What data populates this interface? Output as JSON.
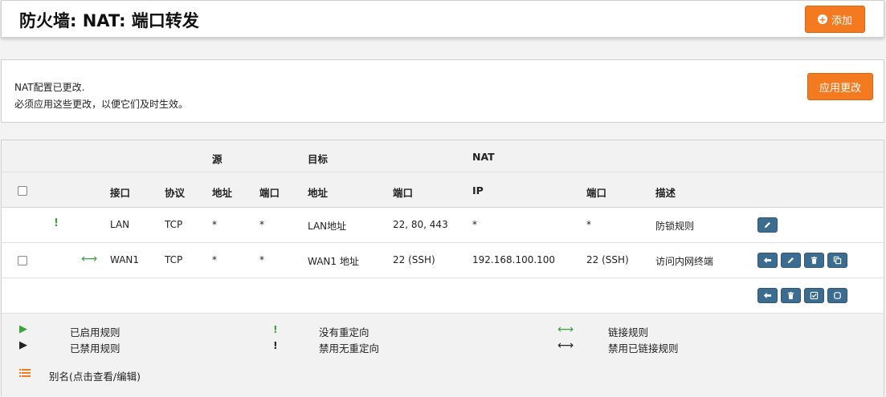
{
  "header": {
    "title": "防火墙: NAT: 端口转发",
    "add_label": "添加"
  },
  "notice": {
    "line1": "NAT配置已更改.",
    "line2": "必须应用这些更改，以便它们及时生效。",
    "apply_label": "应用更改"
  },
  "table": {
    "groups": {
      "source": "源",
      "dest": "目标",
      "nat": "NAT"
    },
    "columns": {
      "interface": "接口",
      "protocol": "协议",
      "src_addr": "地址",
      "src_port": "端口",
      "dst_addr": "地址",
      "dst_port": "端口",
      "nat_ip": "IP",
      "nat_port": "端口",
      "description": "描述"
    },
    "rows": [
      {
        "status_icon": "!",
        "interface": "LAN",
        "protocol": "TCP",
        "src_addr": "*",
        "src_port": "*",
        "dst_addr": "LAN地址",
        "dst_port": "22, 80, 443",
        "nat_ip": "*",
        "nat_port": "*",
        "description": "防锁规则"
      },
      {
        "status_icon": "⟷",
        "interface": "WAN1",
        "protocol": "TCP",
        "src_addr": "*",
        "src_port": "*",
        "dst_addr": "WAN1 地址",
        "dst_port": "22 (SSH)",
        "nat_ip": "192.168.100.100",
        "nat_port": "22 (SSH)",
        "description": "访问内网终端"
      }
    ]
  },
  "legend": {
    "enabled_rule": "已启用规则",
    "disabled_rule": "已禁用规则",
    "no_redirect": "没有重定向",
    "disabled_no_redirect": "禁用无重定向",
    "linked_rule": "链接规则",
    "disabled_linked_rule": "禁用已链接规则",
    "alias_hint": "别名(点击查看/编辑)"
  },
  "colors": {
    "accent": "#f47a20",
    "action_button": "#3c6c8f",
    "enabled_green": "#3aa33a"
  }
}
